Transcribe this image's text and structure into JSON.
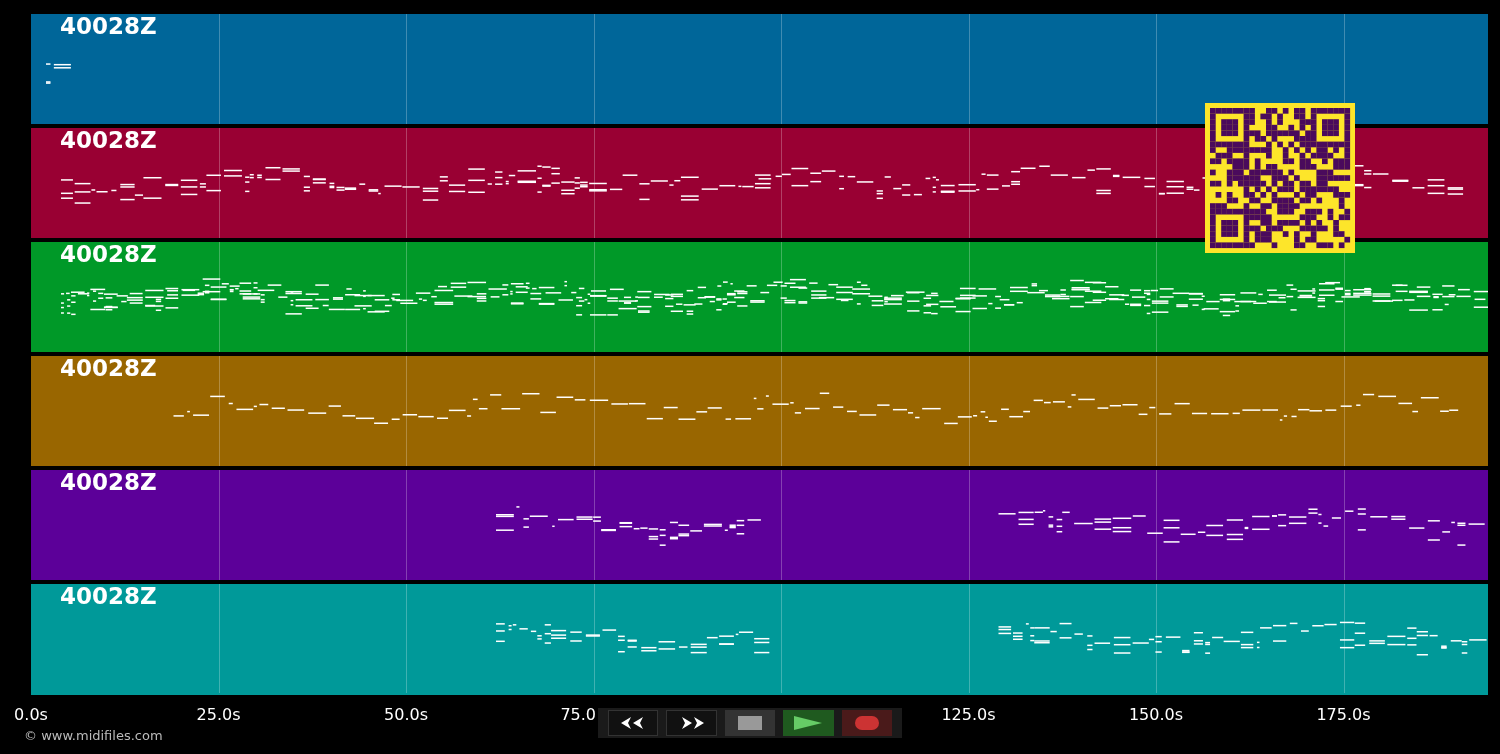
{
  "tracks": [
    {
      "label": "40028Z",
      "color": "#006699"
    },
    {
      "label": "40028Z",
      "color": "#990033"
    },
    {
      "label": "40028Z",
      "color": "#009928"
    },
    {
      "label": "40028Z",
      "color": "#996600"
    },
    {
      "label": "40028Z",
      "color": "#5c0099"
    },
    {
      "label": "40028Z",
      "color": "#009999"
    }
  ],
  "time_axis": {
    "ticks": [
      {
        "label": "0.0s"
      },
      {
        "label": "25.0s"
      },
      {
        "label": "50.0s"
      },
      {
        "label": "75.0"
      },
      {
        "label": "125.0s"
      },
      {
        "label": "150.0s"
      },
      {
        "label": "175.0s"
      }
    ]
  },
  "copyright": "© www.midifiles.com",
  "controls": [
    {
      "kind": "rewind"
    },
    {
      "kind": "forward"
    },
    {
      "kind": "stop"
    },
    {
      "kind": "play"
    },
    {
      "kind": "record"
    }
  ]
}
